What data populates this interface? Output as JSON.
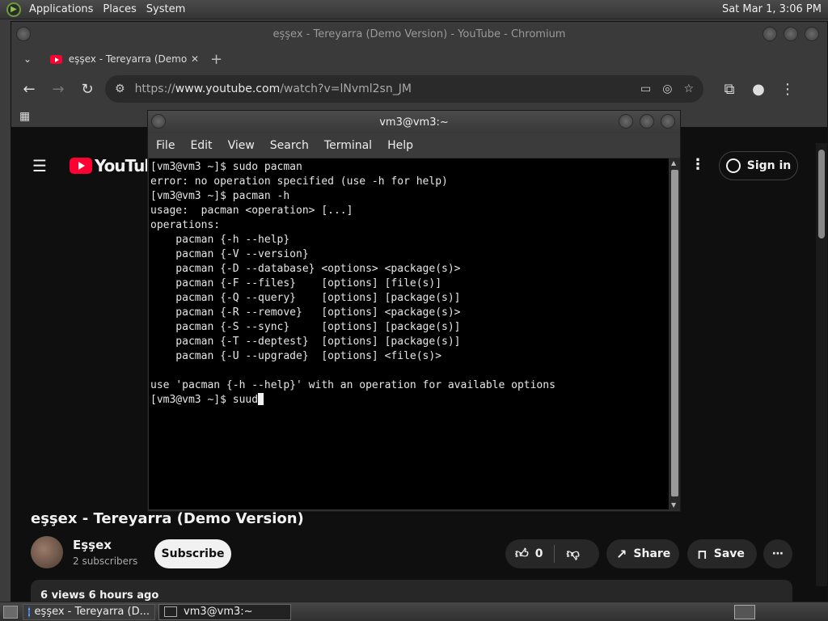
{
  "top_panel": {
    "menus": [
      "Applications",
      "Places",
      "System"
    ],
    "clock": "Sat Mar 1, 3:06 PM"
  },
  "chrome": {
    "window_title": "eşşex - Tereyarra (Demo Version) - YouTube - Chromium",
    "tab_title": "eşşex - Tereyarra (Demo Version) - YouTube",
    "url_scheme": "https://",
    "url_host": "www.youtube.com",
    "url_path": "/watch?v=lNvml2sn_JM"
  },
  "youtube": {
    "logo_text": "YouTube",
    "sign_in": "Sign in",
    "video_title": "eşşex - Tereyarra (Demo Version)",
    "channel_name": "Eşşex",
    "subscribers": "2 subscribers",
    "subscribe": "Subscribe",
    "likes": "0",
    "share": "Share",
    "save": "Save",
    "description_meta": "6 views  6 hours ago"
  },
  "terminal": {
    "title": "vm3@vm3:~",
    "menu": [
      "File",
      "Edit",
      "View",
      "Search",
      "Terminal",
      "Help"
    ],
    "lines": [
      "[vm3@vm3 ~]$ sudo pacman",
      "error: no operation specified (use -h for help)",
      "[vm3@vm3 ~]$ pacman -h",
      "usage:  pacman <operation> [...]",
      "operations:",
      "    pacman {-h --help}",
      "    pacman {-V --version}",
      "    pacman {-D --database} <options> <package(s)>",
      "    pacman {-F --files}    [options] [file(s)]",
      "    pacman {-Q --query}    [options] [package(s)]",
      "    pacman {-R --remove}   [options] <package(s)>",
      "    pacman {-S --sync}     [options] [package(s)]",
      "    pacman {-T --deptest}  [options] [package(s)]",
      "    pacman {-U --upgrade}  [options] <file(s)>",
      "",
      "use 'pacman {-h --help}' with an operation for available options"
    ],
    "prompt_line": "[vm3@vm3 ~]$ suud"
  },
  "taskbar": {
    "task_chromium": "eşşex - Tereyarra (D...",
    "task_terminal": "vm3@vm3:~"
  }
}
